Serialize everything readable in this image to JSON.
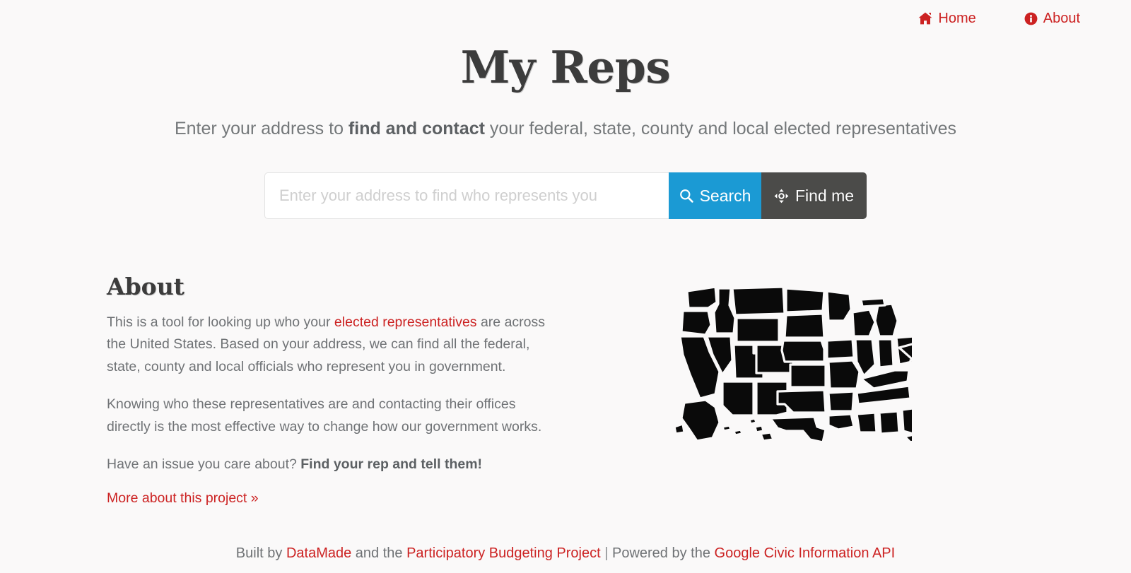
{
  "theme": {
    "background": "#faf9f9",
    "link_red": "#cc2222",
    "search_blue": "#1b9ad4",
    "findme_dark": "#4b4b49",
    "heading_dark": "#3c3c3c",
    "body_gray": "#6f7275"
  },
  "nav": {
    "items": [
      {
        "label": "Home",
        "icon": "home-icon"
      },
      {
        "label": "About",
        "icon": "info-circle-icon"
      }
    ]
  },
  "hero": {
    "title": "My Reps",
    "subtitle_part1": "Enter your address to ",
    "subtitle_bold": "find and contact",
    "subtitle_part2": " your federal, state, county and local elected representatives"
  },
  "search": {
    "placeholder": "Enter your address to find who represents you",
    "value": "",
    "search_label": "Search",
    "search_icon": "magnifier-icon",
    "findme_label": "Find me",
    "findme_icon": "crosshair-arrows-icon"
  },
  "about": {
    "heading": "About",
    "p1_part1": "This is a tool for looking up who your ",
    "p1_link": "elected representatives",
    "p1_part2": " are across the United States. Based on your address, we can find all the federal, state, county and local officials who represent you in government.",
    "p2": "Knowing who these representatives are and contacting their offices directly is the most effective way to change how our government works.",
    "p3_part1": "Have an issue you care about? ",
    "p3_bold": "Find your rep and tell them!",
    "more_link": "More about this project »",
    "map_alt": "us-states-map"
  },
  "footer": {
    "built_by": "Built by ",
    "datamade": "DataMade",
    "and_the": " and the ",
    "pbp": "Participatory Budgeting Project",
    "separator": " | ",
    "powered_by": "Powered by the ",
    "google_api": "Google Civic Information API"
  }
}
